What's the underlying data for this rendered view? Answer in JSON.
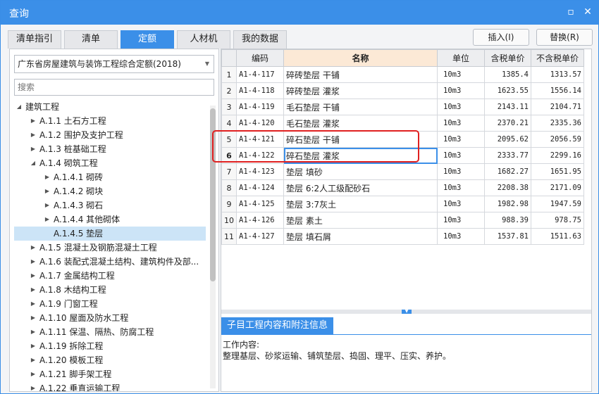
{
  "window": {
    "title": "查询",
    "close_label": "✕"
  },
  "tabs": [
    {
      "label": "清单指引"
    },
    {
      "label": "清单"
    },
    {
      "label": "定额"
    },
    {
      "label": "人材机"
    },
    {
      "label": "我的数据"
    }
  ],
  "buttons": {
    "insert": "插入(I)",
    "replace": "替换(R)"
  },
  "left": {
    "library": "广东省房屋建筑与装饰工程综合定额(2018)",
    "search_placeholder": "搜索",
    "tree": [
      {
        "label": "建筑工程",
        "arrow": "◢"
      },
      {
        "label": "A.1.1 土石方工程",
        "arrow": "▶"
      },
      {
        "label": "A.1.2 围护及支护工程",
        "arrow": "▶"
      },
      {
        "label": "A.1.3 桩基础工程",
        "arrow": "▶"
      },
      {
        "label": "A.1.4 砌筑工程",
        "arrow": "◢"
      },
      {
        "label": "A.1.4.1 砌砖",
        "arrow": "▶"
      },
      {
        "label": "A.1.4.2 砌块",
        "arrow": "▶"
      },
      {
        "label": "A.1.4.3 砌石",
        "arrow": "▶"
      },
      {
        "label": "A.1.4.4 其他砌体",
        "arrow": "▶"
      },
      {
        "label": "A.1.4.5 垫层",
        "arrow": ""
      },
      {
        "label": "A.1.5 混凝土及钢筋混凝土工程",
        "arrow": "▶"
      },
      {
        "label": "A.1.6 装配式混凝土结构、建筑构件及部...",
        "arrow": "▶"
      },
      {
        "label": "A.1.7 金属结构工程",
        "arrow": "▶"
      },
      {
        "label": "A.1.8 木结构工程",
        "arrow": "▶"
      },
      {
        "label": "A.1.9 门窗工程",
        "arrow": "▶"
      },
      {
        "label": "A.1.10 屋面及防水工程",
        "arrow": "▶"
      },
      {
        "label": "A.1.11 保温、隔热、防腐工程",
        "arrow": "▶"
      },
      {
        "label": "A.1.19 拆除工程",
        "arrow": "▶"
      },
      {
        "label": "A.1.20 模板工程",
        "arrow": "▶"
      },
      {
        "label": "A.1.21 脚手架工程",
        "arrow": "▶"
      },
      {
        "label": "A.1.22 垂直运输工程",
        "arrow": "▶"
      }
    ]
  },
  "table": {
    "headers": {
      "code": "编码",
      "name": "名称",
      "unit": "单位",
      "tax": "含税单价",
      "notax": "不含税单价"
    },
    "rows": [
      {
        "idx": "1",
        "code": "A1-4-117",
        "name": "碎砖垫层 干铺",
        "unit": "10m3",
        "tax": "1385.4",
        "notax": "1313.57"
      },
      {
        "idx": "2",
        "code": "A1-4-118",
        "name": "碎砖垫层 灌浆",
        "unit": "10m3",
        "tax": "1623.55",
        "notax": "1556.14"
      },
      {
        "idx": "3",
        "code": "A1-4-119",
        "name": "毛石垫层 干铺",
        "unit": "10m3",
        "tax": "2143.11",
        "notax": "2104.71"
      },
      {
        "idx": "4",
        "code": "A1-4-120",
        "name": "毛石垫层 灌浆",
        "unit": "10m3",
        "tax": "2370.21",
        "notax": "2335.36"
      },
      {
        "idx": "5",
        "code": "A1-4-121",
        "name": "碎石垫层 干铺",
        "unit": "10m3",
        "tax": "2095.62",
        "notax": "2056.59"
      },
      {
        "idx": "6",
        "code": "A1-4-122",
        "name": "碎石垫层 灌浆",
        "unit": "10m3",
        "tax": "2333.77",
        "notax": "2299.16"
      },
      {
        "idx": "7",
        "code": "A1-4-123",
        "name": "垫层 填砂",
        "unit": "10m3",
        "tax": "1682.27",
        "notax": "1651.95"
      },
      {
        "idx": "8",
        "code": "A1-4-124",
        "name": "垫层 6:2人工级配砂石",
        "unit": "10m3",
        "tax": "2208.38",
        "notax": "2171.09"
      },
      {
        "idx": "9",
        "code": "A1-4-125",
        "name": "垫层 3:7灰土",
        "unit": "10m3",
        "tax": "1982.98",
        "notax": "1947.59"
      },
      {
        "idx": "10",
        "code": "A1-4-126",
        "name": "垫层 素土",
        "unit": "10m3",
        "tax": "988.39",
        "notax": "978.75"
      },
      {
        "idx": "11",
        "code": "A1-4-127",
        "name": "垫层 填石屑",
        "unit": "10m3",
        "tax": "1537.81",
        "notax": "1511.63"
      }
    ]
  },
  "bottom": {
    "tab": "子目工程内容和附注信息",
    "line1": "工作内容:",
    "line2": "整理基层、砂浆运输、铺筑垫层、捣固、理平、压实、养护。"
  },
  "colors": {
    "accent": "#3b8fe8",
    "highlight": "#e02020",
    "selected": "#cce4f7"
  }
}
